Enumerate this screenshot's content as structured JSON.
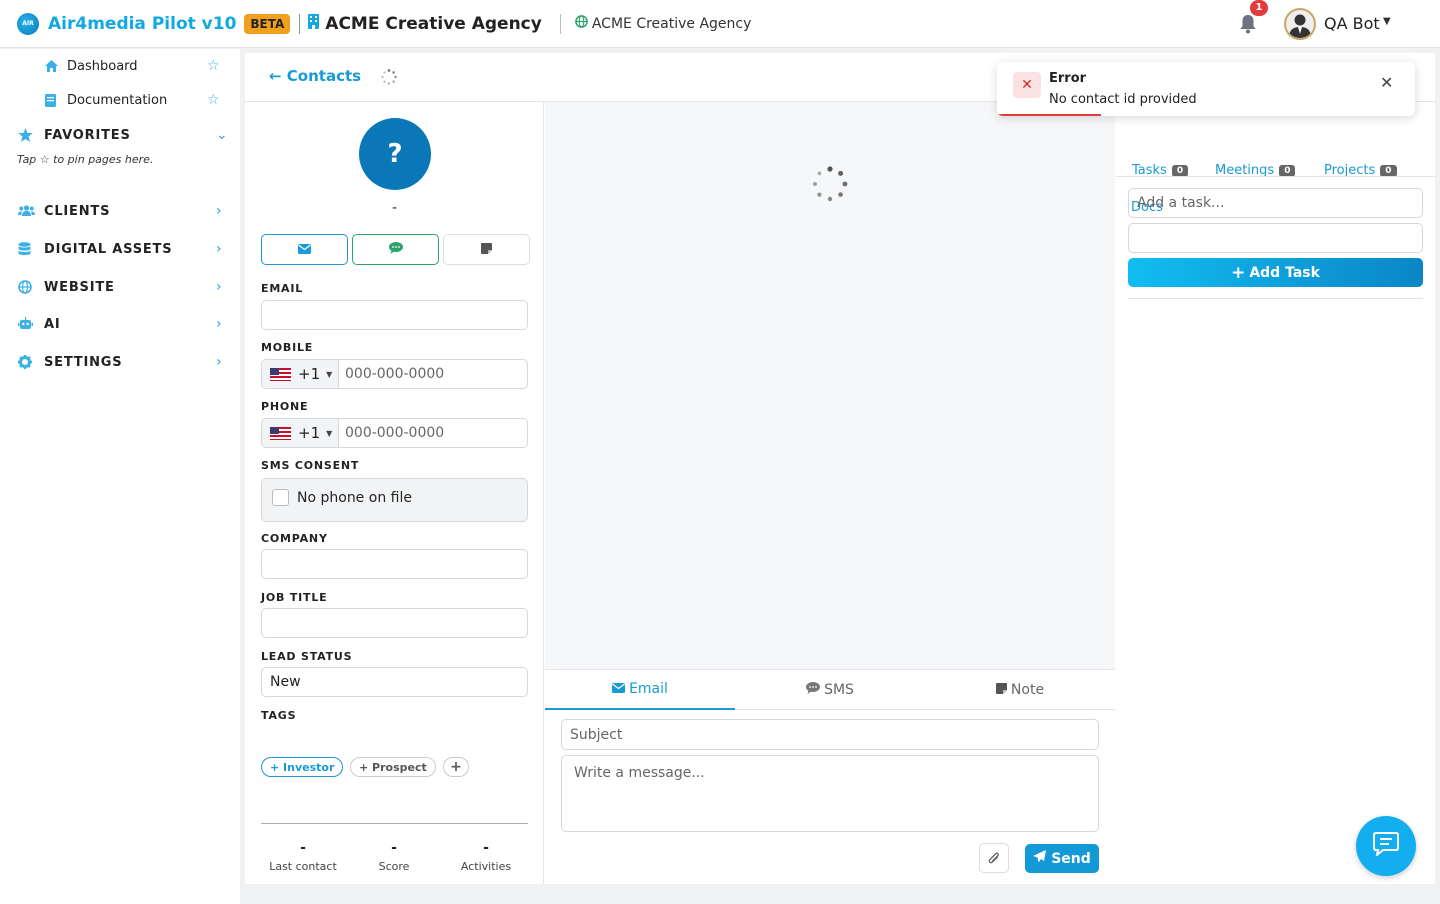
{
  "topbar": {
    "logo_text": "AIR",
    "app_title": "Air4media Pilot v10",
    "beta_label": "BETA",
    "agency_name": "ACME Creative Agency",
    "site_name": "ACME Creative Agency",
    "notification_count": "1",
    "user_name": "QA Bot"
  },
  "sidebar": {
    "subitems": [
      {
        "label": "Dashboard",
        "icon": "home-icon"
      },
      {
        "label": "Documentation",
        "icon": "book-icon"
      }
    ],
    "favorites_label": "FAVORITES",
    "favorites_hint": "Tap ☆ to pin pages here.",
    "sections": [
      {
        "label": "CLIENTS",
        "icon": "users-icon"
      },
      {
        "label": "DIGITAL ASSETS",
        "icon": "database-icon"
      },
      {
        "label": "WEBSITE",
        "icon": "globe-icon"
      },
      {
        "label": "AI",
        "icon": "robot-icon"
      },
      {
        "label": "SETTINGS",
        "icon": "gear-icon"
      }
    ]
  },
  "header": {
    "back_label": "Contacts"
  },
  "contact": {
    "avatar_text": "?",
    "name": "-",
    "fields": {
      "email_label": "EMAIL",
      "mobile_label": "MOBILE",
      "phone_label": "PHONE",
      "country_code": "+1",
      "phone_placeholder": "000-000-0000",
      "sms_consent_label": "SMS CONSENT",
      "sms_consent_text": "No phone on file",
      "company_label": "COMPANY",
      "job_title_label": "JOB TITLE",
      "lead_status_label": "LEAD STATUS",
      "lead_status_value": "New",
      "tags_label": "TAGS"
    },
    "tags": [
      {
        "label": "Investor",
        "active": true
      },
      {
        "label": "Prospect",
        "active": false
      }
    ],
    "stats": [
      {
        "value": "-",
        "label": "Last contact"
      },
      {
        "value": "-",
        "label": "Score"
      },
      {
        "value": "-",
        "label": "Activities"
      }
    ]
  },
  "composer": {
    "tabs": [
      {
        "label": "Email",
        "icon": "envelope-icon",
        "active": true
      },
      {
        "label": "SMS",
        "icon": "sms-icon",
        "active": false
      },
      {
        "label": "Note",
        "icon": "note-icon",
        "active": false
      }
    ],
    "subject_placeholder": "Subject",
    "message_placeholder": "Write a message...",
    "send_label": "Send"
  },
  "right_panel": {
    "tabs": [
      {
        "label": "Tasks",
        "count": "0"
      },
      {
        "label": "Meetings",
        "count": "0"
      },
      {
        "label": "Projects",
        "count": "0"
      },
      {
        "label": "Docs"
      }
    ],
    "task_placeholder": "Add a task...",
    "add_task_label": "Add Task"
  },
  "toast": {
    "title": "Error",
    "message": "No contact id provided"
  },
  "colors": {
    "accent": "#12a8e3",
    "link": "#1a9ad6",
    "beta": "#f0a01c",
    "error": "#e23b3b",
    "success": "#2ca36c"
  }
}
